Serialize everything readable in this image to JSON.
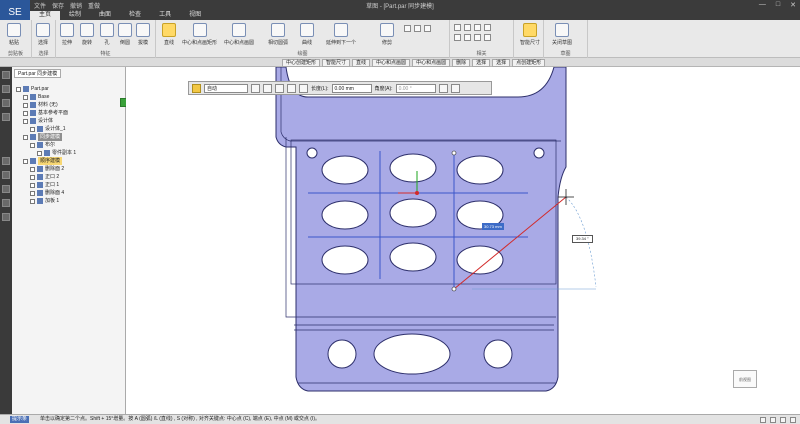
{
  "app": {
    "logo_label": "SE",
    "title": "草图 - [Part.par 同步建模]"
  },
  "qat_items": [
    "文件",
    "保存",
    "撤销",
    "重做"
  ],
  "window_controls": {
    "minimize": "—",
    "maximize": "□",
    "close": "✕"
  },
  "tabs": [
    "主页",
    "绘制",
    "曲面",
    "检查",
    "工具",
    "视图"
  ],
  "ribbon": {
    "groups": [
      {
        "label": "剪贴板",
        "buttons": [
          "粘贴"
        ]
      },
      {
        "label": "选择",
        "buttons": [
          "选择"
        ]
      },
      {
        "label": "特征",
        "buttons": [
          "拉伸",
          "旋转",
          "孔",
          "倒圆",
          "拔模"
        ]
      },
      {
        "label": "绘图",
        "buttons": [
          "直线",
          "中心和点画矩形",
          "中心和点画圆",
          "相切圆弧",
          "曲线",
          "延伸到下一个",
          "修剪"
        ]
      },
      {
        "label": "相关",
        "buttons": [
          "智能尺寸",
          "关系助手"
        ]
      },
      {
        "label": "草图",
        "buttons": [
          "关闭草图"
        ]
      }
    ]
  },
  "command_bar": [
    "中心创建矩形",
    "智能尺寸",
    "直线",
    "中心和点画圆",
    "中心和点画圆",
    "删除",
    "选择",
    "选择",
    "点创建矩形"
  ],
  "left_panel": {
    "tab": "Part.par 同步建模",
    "tree": [
      {
        "label": "Part.par",
        "style": "normal",
        "indent": 0
      },
      {
        "label": "Base",
        "style": "normal",
        "indent": 1
      },
      {
        "label": "材料 (无)",
        "style": "normal",
        "indent": 1
      },
      {
        "label": "基本参考平面",
        "style": "normal",
        "indent": 1
      },
      {
        "label": "设计体",
        "style": "normal",
        "indent": 1
      },
      {
        "label": "设计体_1",
        "style": "normal",
        "indent": 2
      },
      {
        "label": "同步建模",
        "style": "dark",
        "indent": 1
      },
      {
        "label": "布尔",
        "style": "normal",
        "indent": 2
      },
      {
        "label": "零件副本 1",
        "style": "normal",
        "indent": 3
      },
      {
        "label": "顺序建模",
        "style": "yellow",
        "indent": 1
      },
      {
        "label": "删除面 2",
        "style": "normal",
        "indent": 2
      },
      {
        "label": "正口 2",
        "style": "normal",
        "indent": 2
      },
      {
        "label": "正口 1",
        "style": "normal",
        "indent": 2
      },
      {
        "label": "删除面 4",
        "style": "normal",
        "indent": 2
      },
      {
        "label": "加板 1",
        "style": "normal",
        "indent": 2
      }
    ]
  },
  "formatting_bar": {
    "style_select": "自动",
    "length_label": "长度(L):",
    "length_value": "0.00 mm",
    "angle_label": "角度(A):",
    "angle_value": "0.00 °"
  },
  "canvas": {
    "dimension_length": "30.73 mm",
    "dimension_angle": "39.34 °",
    "viewcube_label": "前视图"
  },
  "status": {
    "prompt_button": "提示条",
    "text": "单击以确定第二个点。Shift + 15°增量。按 A (圆弧) /L (直线) , S (对称) , 对齐关键点: 中心点 (C), 端点 (E), 中点 (M) 或交点 (I)。"
  },
  "colors": {
    "part_fill": "#a9aae6",
    "part_edge": "#2d2f6b",
    "sketch_blue": "#3a56c9",
    "sketch_red": "#d22a2a",
    "accent": "#2b579a",
    "highlight": "#ffd966"
  }
}
